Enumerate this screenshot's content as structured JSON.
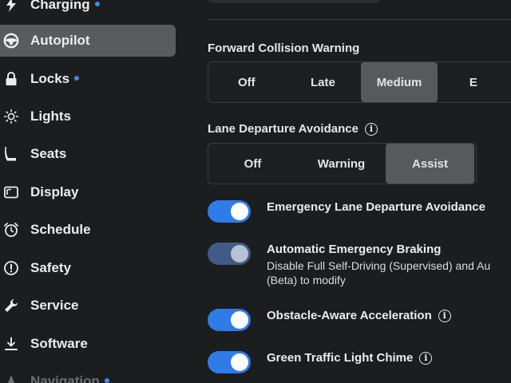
{
  "sidebar": {
    "items": [
      {
        "label": "Charging",
        "icon": "bolt-icon",
        "dot": true
      },
      {
        "label": "Autopilot",
        "icon": "steering-wheel-icon",
        "active": true
      },
      {
        "label": "Locks",
        "icon": "lock-icon",
        "dot": true
      },
      {
        "label": "Lights",
        "icon": "sun-icon"
      },
      {
        "label": "Seats",
        "icon": "seat-icon"
      },
      {
        "label": "Display",
        "icon": "display-icon"
      },
      {
        "label": "Schedule",
        "icon": "alarm-clock-icon"
      },
      {
        "label": "Safety",
        "icon": "alert-circle-icon"
      },
      {
        "label": "Service",
        "icon": "wrench-icon"
      },
      {
        "label": "Software",
        "icon": "download-icon"
      },
      {
        "label": "Navigation",
        "icon": "navigation-icon",
        "dot": true
      }
    ],
    "accent_dot_color": "#3b8cf0"
  },
  "main": {
    "forward_collision": {
      "title": "Forward Collision Warning",
      "options": [
        "Off",
        "Late",
        "Medium",
        "E"
      ],
      "selected": "Medium"
    },
    "lane_departure": {
      "title": "Lane Departure Avoidance",
      "options": [
        "Off",
        "Warning",
        "Assist"
      ],
      "selected": "Assist"
    },
    "toggles": [
      {
        "label": "Emergency Lane Departure Avoidance",
        "on": true,
        "info": false
      },
      {
        "label": "Automatic Emergency Braking",
        "sub1": "Disable Full Self-Driving (Supervised) and Au",
        "sub2": "(Beta) to modify",
        "on": true,
        "disabled": true
      },
      {
        "label": "Obstacle-Aware Acceleration",
        "on": true,
        "info": true
      },
      {
        "label": "Green Traffic Light Chime",
        "on": true,
        "info": true
      }
    ],
    "toggle_color": "#2f7be8"
  }
}
